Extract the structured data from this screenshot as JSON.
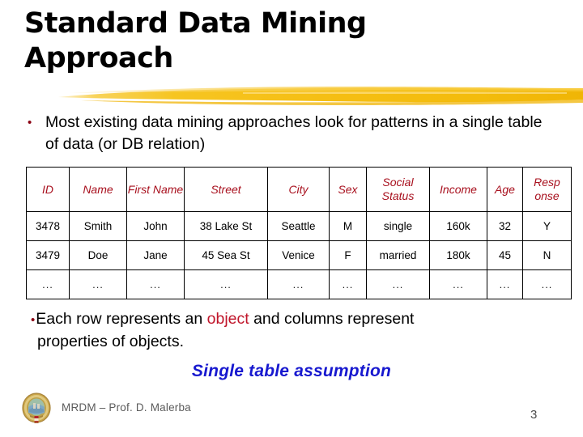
{
  "slide": {
    "title": "Standard Data Mining\nApproach",
    "page_number": "3",
    "accent_yellow": "#F5C11A",
    "accent_red": "#A8101E",
    "accent_blue": "#1718CF",
    "bullet_marker": "•"
  },
  "bullets": {
    "first": {
      "marker": "•",
      "text": "Most existing data mining approaches look for patterns in a single table of data (or DB relation)"
    },
    "second": {
      "marker": "•",
      "part1": "Each row represents an ",
      "highlight": "object",
      "part2": " and columns represent",
      "line2": "properties of objects."
    }
  },
  "emphasis": {
    "text": "Single table assumption"
  },
  "table": {
    "headers": [
      "ID",
      "Name",
      "First Name",
      "Street",
      "City",
      "Sex",
      "Social Status",
      "Income",
      "Age",
      "Resp onse"
    ],
    "rows": [
      [
        "3478",
        "Smith",
        "John",
        "38 Lake St",
        "Seattle",
        "M",
        "single",
        "160k",
        "32",
        "Y"
      ],
      [
        "3479",
        "Doe",
        "Jane",
        "45 Sea St",
        "Venice",
        "F",
        "married",
        "180k",
        "45",
        "N"
      ],
      [
        "...",
        "...",
        "...",
        "...",
        "...",
        "...",
        "...",
        "...",
        "...",
        "..."
      ]
    ]
  },
  "footer": {
    "text": "MRDM – Prof. D. Malerba",
    "logo_name": "university-crest-logo"
  }
}
